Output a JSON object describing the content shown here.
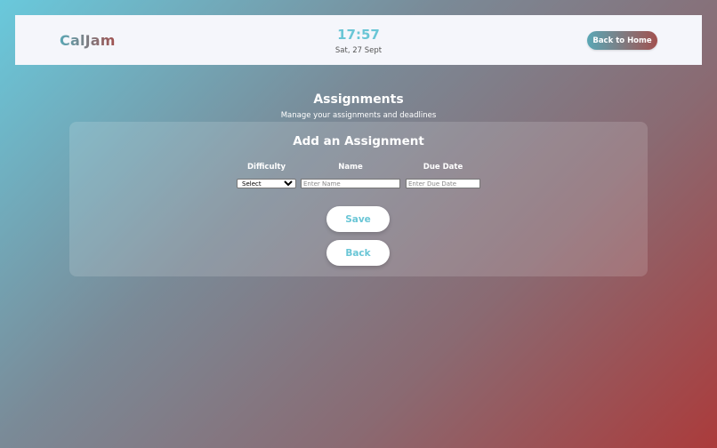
{
  "header": {
    "logo": "CalJam",
    "time": "17:57",
    "date": "Sat, 27 Sept",
    "home_button": "Back to Home"
  },
  "page": {
    "title": "Assignments",
    "subtitle": "Manage your assignments and deadlines"
  },
  "form": {
    "title": "Add an Assignment",
    "columns": {
      "difficulty": "Difficulty",
      "name": "Name",
      "due_date": "Due Date"
    },
    "difficulty_selected": "Select",
    "name_placeholder": "Enter Name",
    "due_date_placeholder": "Enter Due Date",
    "save_label": "Save",
    "back_label": "Back"
  },
  "colors": {
    "accent": "#6ac6d6",
    "brand_start": "#5aa7b5",
    "brand_end": "#a2514f"
  }
}
